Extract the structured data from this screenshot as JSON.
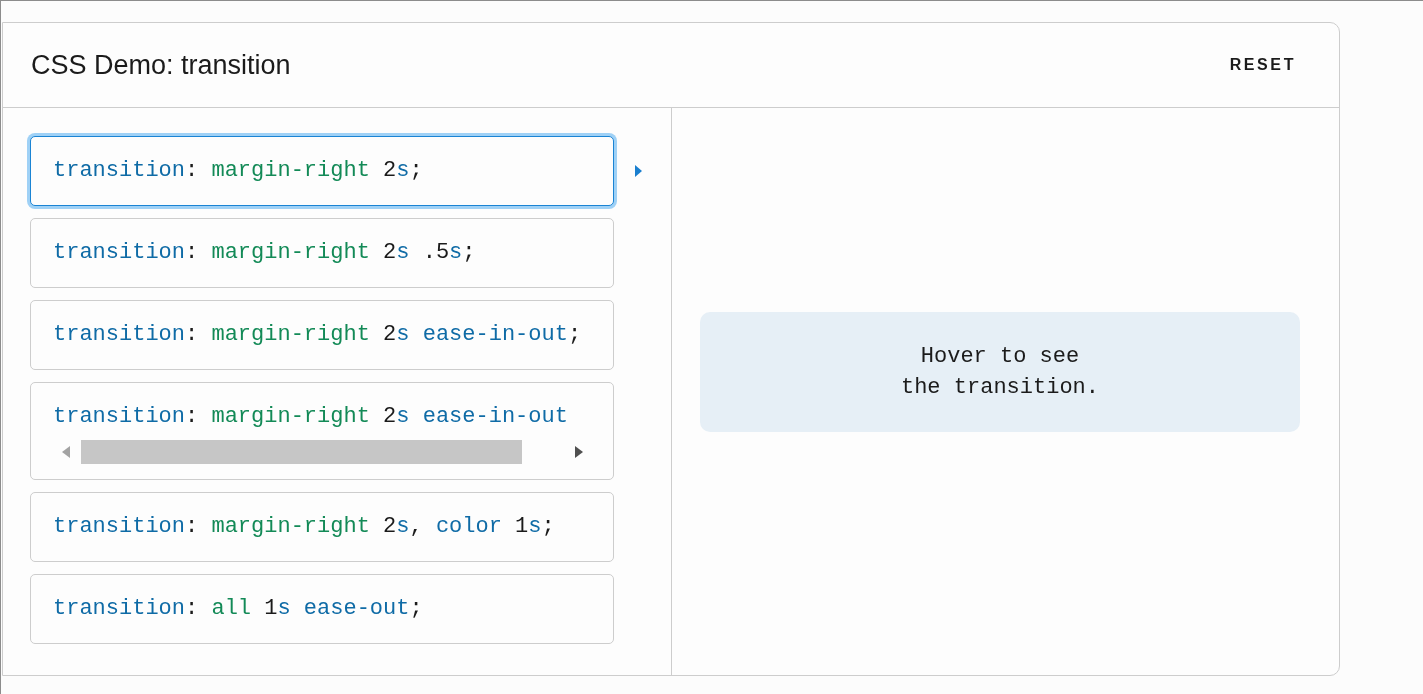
{
  "demo": {
    "title": "CSS Demo: transition",
    "reset_label": "RESET"
  },
  "examples": [
    {
      "kind": "plain",
      "selected": true,
      "tokens": [
        {
          "text": "transition",
          "kind": "property"
        },
        {
          "text": ": ",
          "kind": "punctuation"
        },
        {
          "text": "margin-right",
          "kind": "value"
        },
        {
          "text": " 2",
          "kind": "number"
        },
        {
          "text": "s",
          "kind": "unit"
        },
        {
          "text": ";",
          "kind": "punctuation"
        }
      ]
    },
    {
      "kind": "plain",
      "selected": false,
      "tokens": [
        {
          "text": "transition",
          "kind": "property"
        },
        {
          "text": ": ",
          "kind": "punctuation"
        },
        {
          "text": "margin-right",
          "kind": "value"
        },
        {
          "text": " 2",
          "kind": "number"
        },
        {
          "text": "s",
          "kind": "unit"
        },
        {
          "text": " .5",
          "kind": "number"
        },
        {
          "text": "s",
          "kind": "unit"
        },
        {
          "text": ";",
          "kind": "punctuation"
        }
      ]
    },
    {
      "kind": "plain",
      "selected": false,
      "tokens": [
        {
          "text": "transition",
          "kind": "property"
        },
        {
          "text": ": ",
          "kind": "punctuation"
        },
        {
          "text": "margin-right",
          "kind": "value"
        },
        {
          "text": " 2",
          "kind": "number"
        },
        {
          "text": "s",
          "kind": "unit"
        },
        {
          "text": " ease-in-out",
          "kind": "keyword"
        },
        {
          "text": ";",
          "kind": "punctuation"
        }
      ]
    },
    {
      "kind": "scrolling",
      "selected": false,
      "tokens": [
        {
          "text": "transition",
          "kind": "property"
        },
        {
          "text": ": ",
          "kind": "punctuation"
        },
        {
          "text": "margin-right",
          "kind": "value"
        },
        {
          "text": " 2",
          "kind": "number"
        },
        {
          "text": "s",
          "kind": "unit"
        },
        {
          "text": " ease-in-out",
          "kind": "keyword"
        }
      ]
    },
    {
      "kind": "plain",
      "selected": false,
      "tokens": [
        {
          "text": "transition",
          "kind": "property"
        },
        {
          "text": ": ",
          "kind": "punctuation"
        },
        {
          "text": "margin-right",
          "kind": "value"
        },
        {
          "text": " 2",
          "kind": "number"
        },
        {
          "text": "s",
          "kind": "unit"
        },
        {
          "text": ", ",
          "kind": "punctuation"
        },
        {
          "text": "color",
          "kind": "property"
        },
        {
          "text": " 1",
          "kind": "number"
        },
        {
          "text": "s",
          "kind": "unit"
        },
        {
          "text": ";",
          "kind": "punctuation"
        }
      ]
    },
    {
      "kind": "plain",
      "selected": false,
      "tokens": [
        {
          "text": "transition",
          "kind": "property"
        },
        {
          "text": ": ",
          "kind": "punctuation"
        },
        {
          "text": "all",
          "kind": "value"
        },
        {
          "text": " 1",
          "kind": "number"
        },
        {
          "text": "s",
          "kind": "unit"
        },
        {
          "text": " ease-out",
          "kind": "keyword"
        },
        {
          "text": ";",
          "kind": "punctuation"
        }
      ]
    }
  ],
  "preview": {
    "text": "Hover to see the transition."
  }
}
